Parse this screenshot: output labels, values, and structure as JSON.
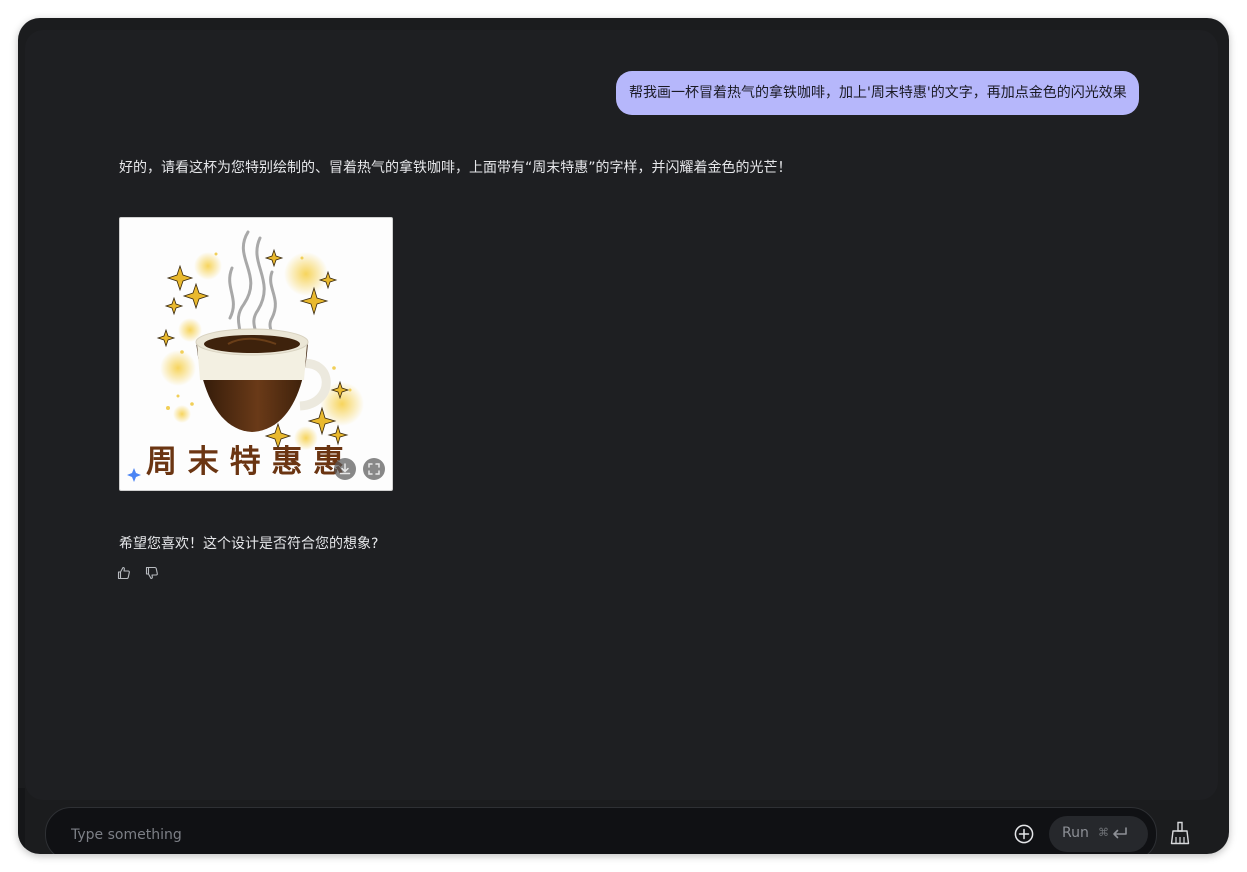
{
  "chat": {
    "user_message": "帮我画一杯冒着热气的拿铁咖啡，加上'周末特惠'的文字，再加点金色的闪光效果",
    "assistant_reply": "好的，请看这杯为您特别绘制的、冒着热气的拿铁咖啡，上面带有“周末特惠”的字样，并闪耀着金色的光芒！",
    "generated_image": {
      "caption_text": "周 末 特 惠 惠",
      "icons": {
        "download": "download-icon",
        "expand": "fullscreen-icon",
        "badge": "sparkle-badge-icon"
      }
    },
    "followup": "希望您喜欢！这个设计是否符合您的想象?",
    "feedback_icons": [
      "thumbs-up-icon",
      "thumbs-down-icon"
    ]
  },
  "composer": {
    "placeholder": "Type something",
    "run_label": "Run",
    "shortcut": "⌘",
    "add_icon": "plus-circle-icon",
    "clear_icon": "broom-icon"
  },
  "colors": {
    "background": "#1e1f22",
    "user_bubble": "#b6b7fb",
    "text": "#e6e7ea",
    "gold": "#e9b92e",
    "coffee": "#4a2a14",
    "foam": "#f3f0e2"
  }
}
